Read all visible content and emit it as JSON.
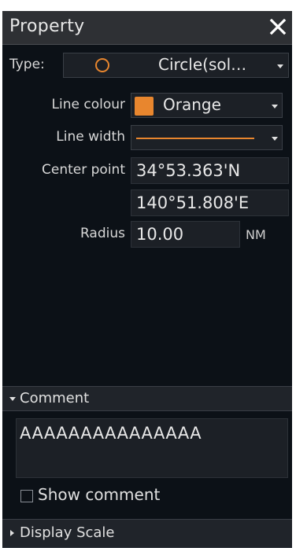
{
  "window": {
    "title": "Property",
    "close_icon": "close-icon"
  },
  "type": {
    "label": "Type:",
    "value": "Circle(sol…",
    "icon": "circle-outline-icon"
  },
  "line_colour": {
    "label": "Line colour",
    "value": "Orange",
    "color": "#e8862e"
  },
  "line_width": {
    "label": "Line width"
  },
  "center_point": {
    "label": "Center point",
    "latitude": "34°53.363'N",
    "longitude": "140°51.808'E"
  },
  "radius": {
    "label": "Radius",
    "value": "10.00",
    "unit": "NM"
  },
  "comment_section": {
    "label": "Comment",
    "text": "AAAAAAAAAAAAAAA"
  },
  "show_comment": {
    "label": "Show comment",
    "checked": false
  },
  "display_scale_section": {
    "label": "Display Scale"
  }
}
